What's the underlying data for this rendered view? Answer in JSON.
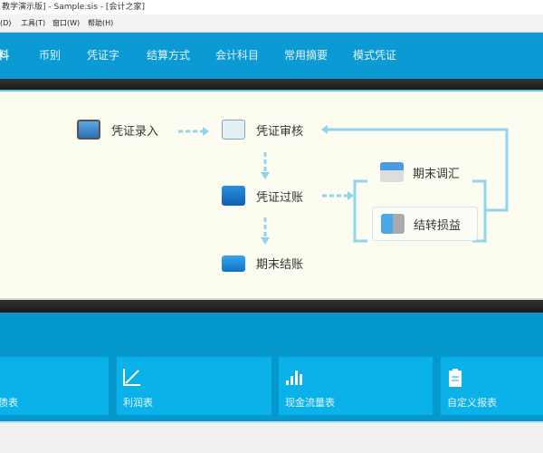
{
  "window": {
    "title": "教学演示版] - Sample.sis - [会计之家]"
  },
  "menu": {
    "items": [
      "(D)",
      "工具(T)",
      "窗口(W)",
      "帮助(H)"
    ]
  },
  "toolbar": {
    "items": [
      "料",
      "币别",
      "凭证字",
      "结算方式",
      "会计科目",
      "常用摘要",
      "模式凭证"
    ]
  },
  "flow": {
    "voucher_entry": "凭证录入",
    "voucher_audit": "凭证审核",
    "voucher_post": "凭证过账",
    "period_close": "期末结账",
    "period_exchange": "期末调汇",
    "transfer_pl": "结转损益"
  },
  "reports": {
    "items": [
      {
        "label": "债表",
        "icon": "balance-sheet-icon"
      },
      {
        "label": "利润表",
        "icon": "line-chart-icon"
      },
      {
        "label": "现金流量表",
        "icon": "bar-chart-icon"
      },
      {
        "label": "自定义报表",
        "icon": "clipboard-icon"
      }
    ]
  },
  "colors": {
    "toolbar": "#0b9ad3",
    "panel": "#fdfcf0",
    "tile": "#0bb2ea",
    "connector": "#8fd3ee"
  }
}
